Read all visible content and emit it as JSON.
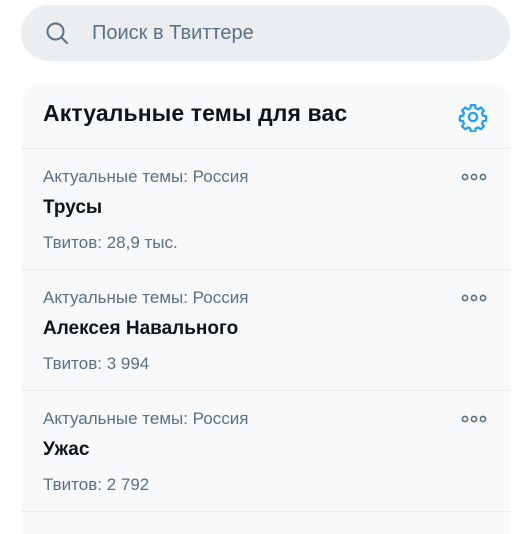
{
  "search": {
    "placeholder": "Поиск в Твиттере",
    "icon": "search-icon"
  },
  "trends_panel": {
    "title": "Актуальные темы для вас",
    "settings_icon": "gear-icon",
    "accent_color": "#1da1f2",
    "items": [
      {
        "context": "Актуальные темы: Россия",
        "name": "Трусы",
        "count": "Твитов: 28,9 тыс.",
        "menu_icon": "more-horizontal-icon"
      },
      {
        "context": "Актуальные темы: Россия",
        "name": "Алексея Навального",
        "count": "Твитов: 3 994",
        "menu_icon": "more-horizontal-icon"
      },
      {
        "context": "Актуальные темы: Россия",
        "name": "Ужас",
        "count": "Твитов: 2 792",
        "menu_icon": "more-horizontal-icon"
      }
    ]
  }
}
